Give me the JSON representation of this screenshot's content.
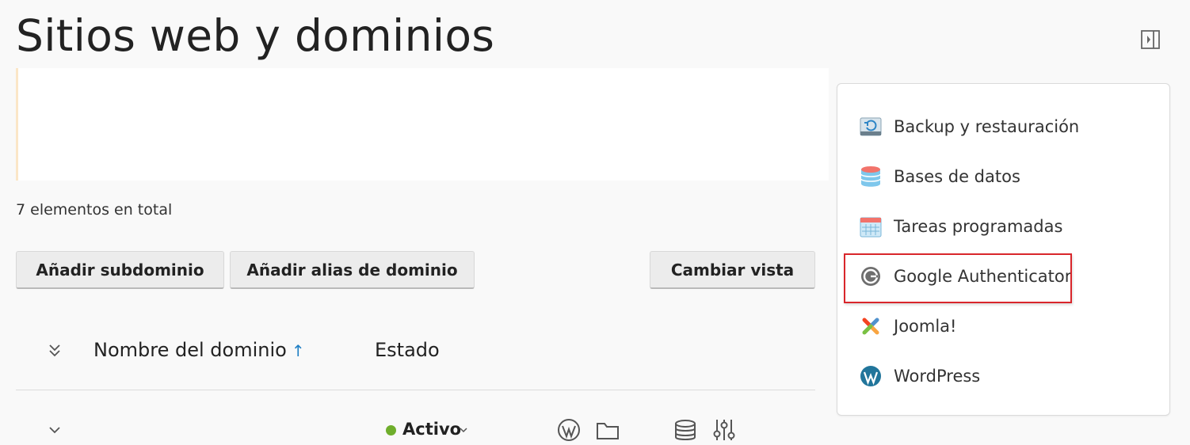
{
  "page": {
    "title": "Sitios web y dominios",
    "total_count": "7 elementos en total"
  },
  "toolbar": {
    "add_subdomain": "Añadir subdominio",
    "add_alias": "Añadir alias de dominio",
    "change_view": "Cambiar vista"
  },
  "table": {
    "columns": {
      "domain": "Nombre del dominio",
      "domain_sort": "↑",
      "status": "Estado"
    },
    "rows": [
      {
        "status": "Activo",
        "status_color": "#6fae2c",
        "icons": [
          "wordpress-icon",
          "folder-icon",
          "database-icon",
          "settings-sliders-icon"
        ]
      }
    ]
  },
  "side_panel": {
    "items": [
      {
        "label": "Backup y restauración",
        "icon": "backup-icon"
      },
      {
        "label": "Bases de datos",
        "icon": "database-icon"
      },
      {
        "label": "Tareas programadas",
        "icon": "calendar-icon"
      },
      {
        "label": "Google Authenticator",
        "icon": "google-authenticator-icon",
        "highlighted": true
      },
      {
        "label": "Joomla!",
        "icon": "joomla-icon"
      },
      {
        "label": "WordPress",
        "icon": "wordpress-icon"
      }
    ]
  },
  "colors": {
    "accent": "#1f7fc4",
    "status_active": "#6fae2c",
    "highlight": "#d9262b"
  }
}
